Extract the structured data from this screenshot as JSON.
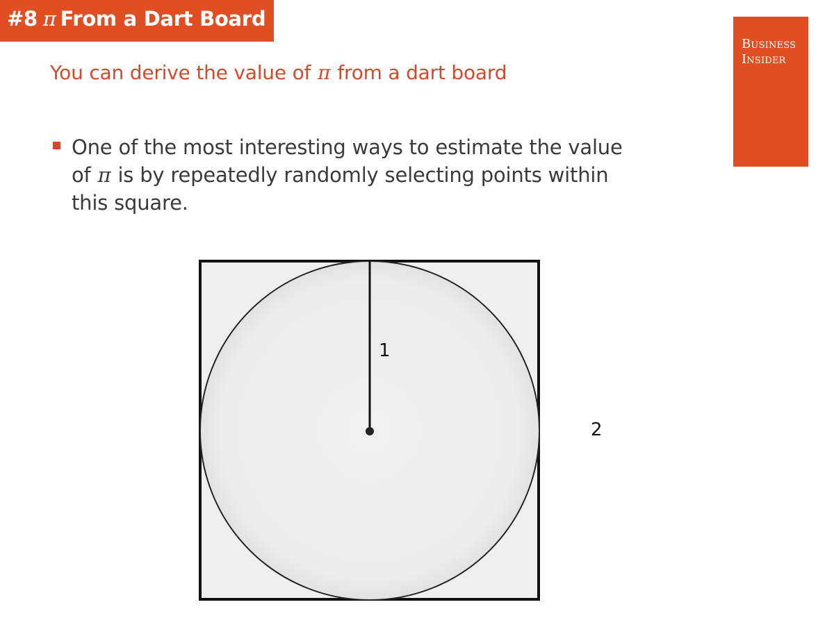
{
  "header": {
    "title_prefix": "#8",
    "title_symbol": "π",
    "title_suffix": "From a Dart Board"
  },
  "subtitle": {
    "before": "You can derive the value of",
    "symbol": "π",
    "after": "from a dart board"
  },
  "logo": {
    "line1": "Business",
    "line2": "Insider"
  },
  "bullet": {
    "line1": "One of the most interesting ways to estimate the value",
    "line2_before": "of",
    "line2_symbol": "π",
    "line2_after": "is by repeatedly randomly selecting points within",
    "line3": "this square."
  },
  "diagram": {
    "radius_label": "1",
    "side_label": "2"
  },
  "colors": {
    "accent": "#e04f23",
    "subtitle": "#d4492b",
    "body_text": "#3a3a3a",
    "square_fill": "#efefef"
  }
}
